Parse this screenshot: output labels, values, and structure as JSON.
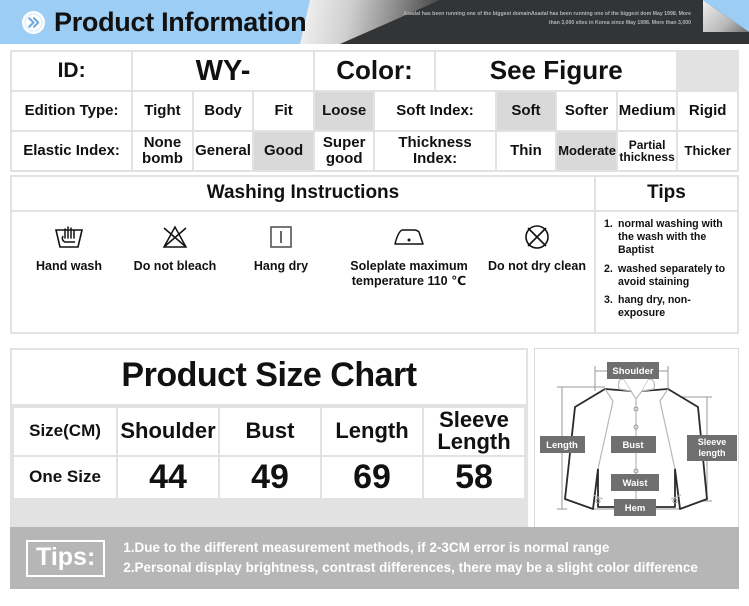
{
  "header": {
    "title": "Product Information",
    "logo_icon": "double-chevron-right-icon",
    "subtitle": "Asadal has been running one of the biggest domainAsadal has been running one of the biggest dom May 1998. More than 3,000 sites in Korea since May 1998. More than 3,000",
    "blue": "#9ccdf5",
    "dark": "#333436"
  },
  "info": {
    "id_label": "ID:",
    "id_value": "WY-",
    "color_label": "Color:",
    "color_value": "See Figure",
    "edition_label": "Edition Type:",
    "edition_options": [
      "Tight",
      "Body",
      "Fit",
      "Loose"
    ],
    "edition_selected": "Loose",
    "soft_label": "Soft Index:",
    "soft_options": [
      "Soft",
      "Softer",
      "Medium",
      "Rigid"
    ],
    "soft_selected": "Soft",
    "elastic_label": "Elastic Index:",
    "elastic_options": [
      "None bomb",
      "General",
      "Good",
      "Super good"
    ],
    "elastic_selected": "Good",
    "thickness_label": "Thickness Index:",
    "thickness_options": [
      "Thin",
      "Moderate",
      "Partial thickness",
      "Thicker"
    ],
    "thickness_selected": "Moderate"
  },
  "washing": {
    "title": "Washing Instructions",
    "items": [
      {
        "icon": "hand-wash-icon",
        "caption": "Hand wash"
      },
      {
        "icon": "do-not-bleach-icon",
        "caption": "Do not bleach"
      },
      {
        "icon": "hang-dry-icon",
        "caption": "Hang dry"
      },
      {
        "icon": "iron-low-temperature-icon",
        "caption": "Soleplate maximum temperature 110 ℃"
      },
      {
        "icon": "do-not-dry-clean-icon",
        "caption": "Do not dry clean"
      }
    ]
  },
  "tips_panel": {
    "title": "Tips",
    "items": [
      {
        "num": "1.",
        "text": "normal washing with the wash with the Baptist"
      },
      {
        "num": "2.",
        "text": "washed separately to avoid staining"
      },
      {
        "num": "3.",
        "text": "hang dry, non-exposure"
      }
    ]
  },
  "size_chart": {
    "title": "Product Size Chart",
    "headers": [
      "Size(CM)",
      "Shoulder",
      "Bust",
      "Length",
      "Sleeve Length"
    ],
    "rows": [
      [
        "One Size",
        "44",
        "49",
        "69",
        "58"
      ]
    ],
    "diagram_labels": {
      "shoulder": "Shoulder",
      "length": "Length",
      "bust": "Bust",
      "sleeve": "Sleeve length",
      "waist": "Waist",
      "hem": "Hem"
    }
  },
  "bottom_tips": {
    "badge": "Tips:",
    "lines": [
      "1.Due to the different measurement methods, if 2-3CM error is normal range",
      "2.Personal display brightness, contrast differences, there may be a slight color difference"
    ],
    "bg": "#b6b6b6"
  }
}
